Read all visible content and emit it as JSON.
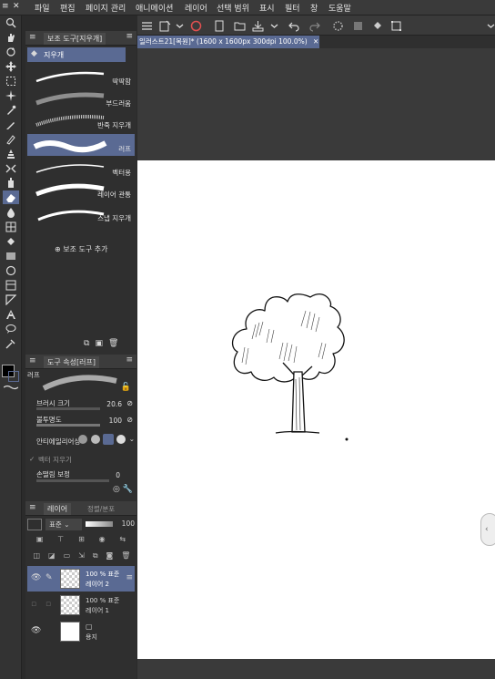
{
  "menu": [
    "파일",
    "편집",
    "페이지 관리",
    "애니메이션",
    "레이어",
    "선택 범위",
    "표시",
    "필터",
    "창",
    "도움말"
  ],
  "document_tab": "일러스트21[복원]* (1600 x 1600px 300dpi 100.0%)",
  "subtool_panel": {
    "title": "보조 도구[지우개]",
    "group": "지우개",
    "brushes": [
      {
        "label": "딱딱함",
        "selected": false
      },
      {
        "label": "부드러움",
        "selected": false
      },
      {
        "label": "반죽 지우개",
        "selected": false
      },
      {
        "label": "러프",
        "selected": true
      },
      {
        "label": "벡터용",
        "selected": false
      },
      {
        "label": "레이어 관통",
        "selected": false
      },
      {
        "label": "스냅 지우개",
        "selected": false
      }
    ],
    "add_label": "보조 도구 추가"
  },
  "tool_property": {
    "title": "도구 속성[러프]",
    "brush_name": "러프",
    "brush_size_label": "브러시 크기",
    "brush_size_value": "20.6",
    "opacity_label": "불투명도",
    "opacity_value": "100",
    "antialias_label": "안티에일리어싱",
    "vector_eraser_label": "벡터 지우기",
    "stabilization_label": "손떨림 보정",
    "stabilization_value": "0"
  },
  "layers_panel": {
    "tab_layer": "레이어",
    "tab_other": "정렬/분포",
    "blend_mode": "표준",
    "opacity": "100",
    "layers": [
      {
        "mode": "100 % 표준",
        "name": "레이어 2",
        "selected": true,
        "visible": true
      },
      {
        "mode": "100 % 표준",
        "name": "레이어 1",
        "selected": false,
        "visible": false
      },
      {
        "mode": "",
        "name": "용지",
        "selected": false,
        "visible": true
      }
    ]
  },
  "colors": {
    "accent": "#5a6a93",
    "panel": "#2f2f2f",
    "paper": "#ffffff"
  }
}
